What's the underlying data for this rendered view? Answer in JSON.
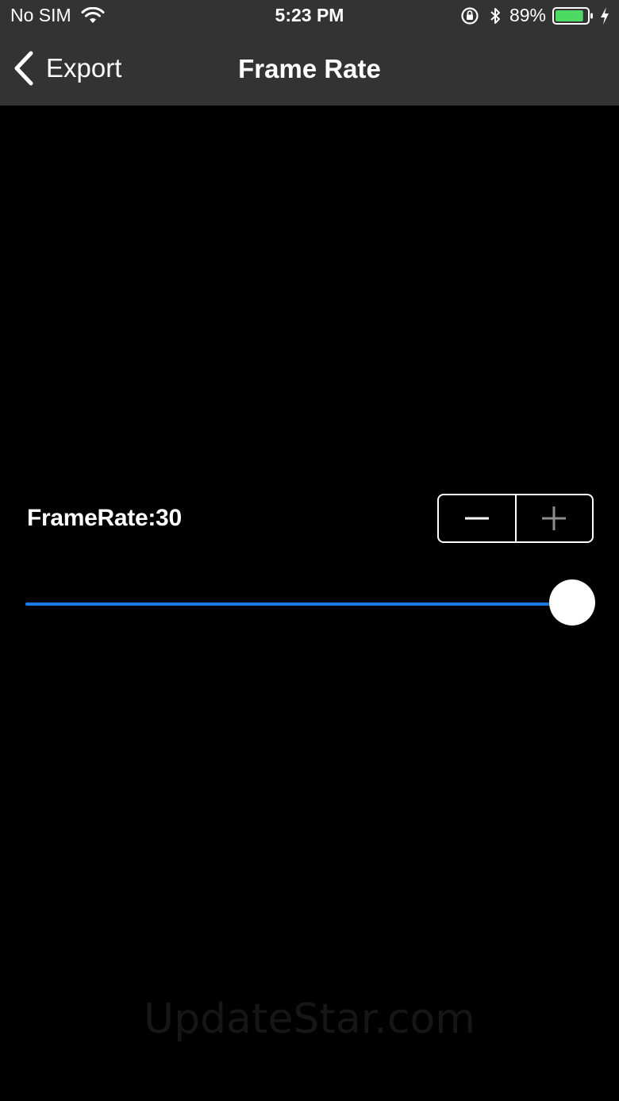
{
  "status_bar": {
    "carrier": "No SIM",
    "time": "5:23 PM",
    "battery_percent": "89%",
    "battery_level": 0.89,
    "battery_color": "#4cd964"
  },
  "nav": {
    "back_label": "Export",
    "title": "Frame Rate"
  },
  "frame_rate": {
    "label": "FrameRate:30",
    "slider_fraction": 1.0,
    "slider_color": "#1e7ae6",
    "stepper_minus_icon": "minus-icon",
    "stepper_plus_icon": "plus-icon"
  },
  "watermark": "UpdateStar.com"
}
